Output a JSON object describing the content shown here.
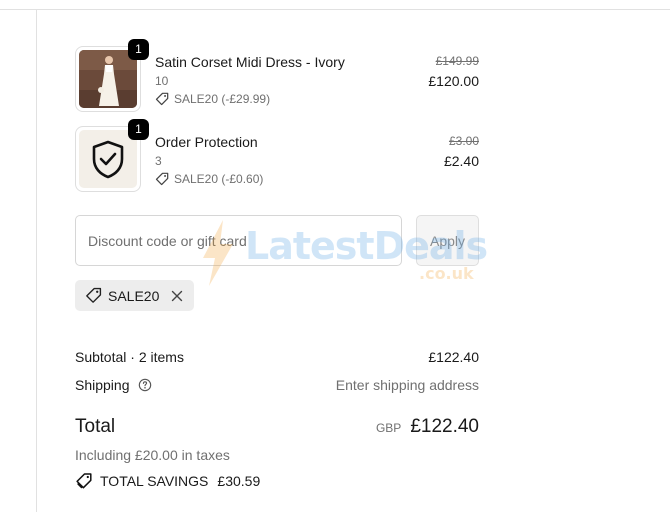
{
  "items": [
    {
      "quantity": "1",
      "name": "Satin Corset Midi Dress - Ivory",
      "variant": "10",
      "discount": "SALE20 (-£29.99)",
      "original_price": "£149.99",
      "price": "£120.00",
      "thumbnail": "dress-photo"
    },
    {
      "quantity": "1",
      "name": "Order Protection",
      "variant": "3",
      "discount": "SALE20 (-£0.60)",
      "original_price": "£3.00",
      "price": "£2.40",
      "thumbnail": "shield-check-icon"
    }
  ],
  "discount": {
    "placeholder": "Discount code or gift card",
    "apply_label": "Apply",
    "applied_code": "SALE20"
  },
  "summary": {
    "subtotal_label": "Subtotal · 2 items",
    "subtotal_value": "£122.40",
    "shipping_label": "Shipping",
    "shipping_value": "Enter shipping address",
    "total_label": "Total",
    "currency": "GBP",
    "total_value": "£122.40",
    "taxes_note": "Including £20.00 in taxes",
    "savings_label": "TOTAL SAVINGS",
    "savings_value": "£30.59"
  },
  "watermark": {
    "text": "LatestDeals",
    "suffix": ".co.uk"
  },
  "colors": {
    "badge_bg": "#000000",
    "muted_text": "#707070",
    "chip_bg": "#ededed",
    "border": "#dedede"
  }
}
